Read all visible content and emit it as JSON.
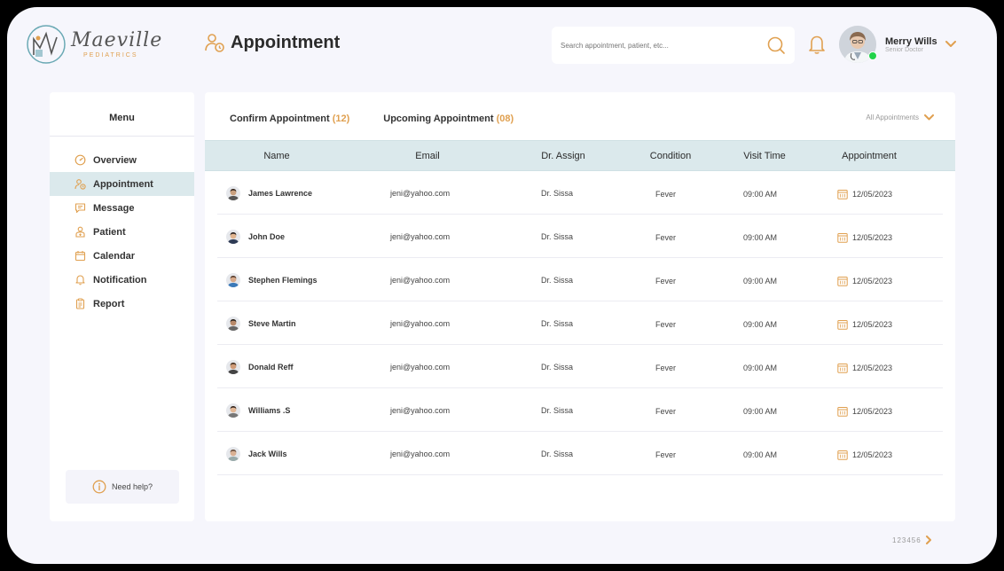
{
  "brand": {
    "name": "Maeville",
    "sub": "PEDIATRICS"
  },
  "header": {
    "title": "Appointment",
    "search_placeholder": "Search appointment, patient, etc...",
    "user": {
      "name": "Merry Wills",
      "role": "Senior Doctor"
    }
  },
  "sidebar": {
    "title": "Menu",
    "items": [
      {
        "label": "Overview",
        "icon": "gauge-icon"
      },
      {
        "label": "Appointment",
        "icon": "user-clock-icon",
        "active": true
      },
      {
        "label": "Message",
        "icon": "message-icon"
      },
      {
        "label": "Patient",
        "icon": "patient-icon"
      },
      {
        "label": "Calendar",
        "icon": "calendar-icon"
      },
      {
        "label": "Notification",
        "icon": "bell-icon"
      },
      {
        "label": "Report",
        "icon": "clipboard-icon"
      }
    ],
    "help_label": "Need help?"
  },
  "main": {
    "tabs": [
      {
        "label": "Confirm Appointment",
        "count": "(12)"
      },
      {
        "label": "Upcoming Appointment",
        "count": "(08)"
      }
    ],
    "filter_label": "All Appointments",
    "columns": [
      "Name",
      "Email",
      "Dr. Assign",
      "Condition",
      "Visit Time",
      "Appointment"
    ],
    "rows": [
      {
        "name": "James Lawrence",
        "email": "jeni@yahoo.com",
        "doctor": "Dr. Sissa",
        "condition": "Fever",
        "time": "09:00 AM",
        "date": "12/05/2023"
      },
      {
        "name": "John Doe",
        "email": "jeni@yahoo.com",
        "doctor": "Dr. Sissa",
        "condition": "Fever",
        "time": "09:00 AM",
        "date": "12/05/2023"
      },
      {
        "name": "Stephen Flemings",
        "email": "jeni@yahoo.com",
        "doctor": "Dr. Sissa",
        "condition": "Fever",
        "time": "09:00 AM",
        "date": "12/05/2023"
      },
      {
        "name": "Steve Martin",
        "email": "jeni@yahoo.com",
        "doctor": "Dr. Sissa",
        "condition": "Fever",
        "time": "09:00 AM",
        "date": "12/05/2023"
      },
      {
        "name": "Donald Reff",
        "email": "jeni@yahoo.com",
        "doctor": "Dr. Sissa",
        "condition": "Fever",
        "time": "09:00 AM",
        "date": "12/05/2023"
      },
      {
        "name": "Williams .S",
        "email": "jeni@yahoo.com",
        "doctor": "Dr. Sissa",
        "condition": "Fever",
        "time": "09:00 AM",
        "date": "12/05/2023"
      },
      {
        "name": "Jack Wills",
        "email": "jeni@yahoo.com",
        "doctor": "Dr. Sissa",
        "condition": "Fever",
        "time": "09:00 AM",
        "date": "12/05/2023"
      }
    ]
  },
  "pagination": {
    "pages": "123456"
  },
  "colors": {
    "accent": "#e0a050",
    "row_highlight": "#dbe9ec",
    "online": "#22d34a"
  }
}
